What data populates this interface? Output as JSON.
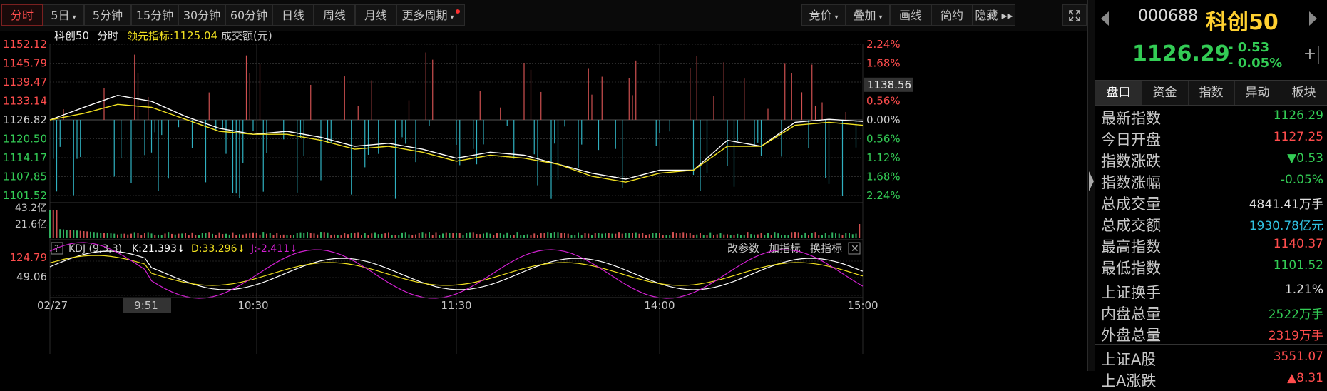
{
  "toolbar": {
    "tabs": [
      {
        "label": "分时",
        "active": true
      },
      {
        "label": "5日",
        "dropdown": true
      },
      {
        "label": "5分钟"
      },
      {
        "label": "15分钟"
      },
      {
        "label": "30分钟"
      },
      {
        "label": "60分钟"
      },
      {
        "label": "日线"
      },
      {
        "label": "周线"
      },
      {
        "label": "月线"
      },
      {
        "label": "更多周期",
        "dropdown": true,
        "dot": true
      }
    ],
    "right_tabs": [
      {
        "label": "竞价",
        "dropdown": true
      },
      {
        "label": "叠加",
        "dropdown": true
      },
      {
        "label": "画线"
      },
      {
        "label": "简约"
      },
      {
        "label": "隐藏 ▸▸"
      }
    ],
    "expand_icon": "fullscreen-icon"
  },
  "chart_header": {
    "name": "科创50",
    "mode": "分时",
    "leading_label": "领先指标:1125.04",
    "volume_label": "成交额(元)"
  },
  "chart_data": [
    {
      "type": "line",
      "title": "",
      "y_left_ticks": [
        "1152.12",
        "1145.79",
        "1139.47",
        "1133.14",
        "1126.82",
        "1120.50",
        "1114.17",
        "1107.85",
        "1101.52"
      ],
      "y_right_ticks": [
        "2.24%",
        "1.68%",
        "1.12%",
        "0.56%",
        "0.00%",
        "0.56%",
        "1.12%",
        "1.68%",
        "2.24%"
      ],
      "current_tag": "1138.56",
      "ylim": [
        1101.52,
        1152.12
      ],
      "x_ticks": [
        "02/27",
        "9:51",
        "10:30",
        "11:30",
        "14:00",
        "15:00"
      ],
      "series": [
        {
          "name": "科创50",
          "color": "#ffffff",
          "x": [
            0,
            10,
            20,
            30,
            40,
            50,
            60,
            70,
            80,
            90,
            100,
            110,
            120,
            130,
            140,
            150,
            160,
            170,
            180,
            190,
            200,
            210,
            220,
            230,
            240
          ],
          "values": [
            1126.8,
            1131,
            1135,
            1133,
            1128,
            1124,
            1122,
            1123,
            1121,
            1118,
            1119,
            1117,
            1114,
            1116,
            1115,
            1112,
            1109,
            1107,
            1110,
            1110,
            1120,
            1118,
            1126,
            1127,
            1126.3
          ]
        },
        {
          "name": "领先指标",
          "color": "#f0e020",
          "x": [
            0,
            10,
            20,
            30,
            40,
            50,
            60,
            70,
            80,
            90,
            100,
            110,
            120,
            130,
            140,
            150,
            160,
            170,
            180,
            190,
            200,
            210,
            220,
            230,
            240
          ],
          "values": [
            1126.8,
            1129,
            1132,
            1131,
            1127,
            1123,
            1122,
            1122,
            1120,
            1117,
            1118,
            1116,
            1113,
            1115,
            1114,
            1112,
            1108,
            1106,
            1109,
            1110,
            1118,
            1118,
            1125,
            1126,
            1125.0
          ]
        }
      ]
    },
    {
      "type": "bar",
      "title": "",
      "y_ticks": [
        "43.2亿",
        "21.6亿"
      ],
      "ylim": [
        0,
        43.2
      ]
    },
    {
      "type": "line",
      "title": "",
      "indicator_label": "KDJ (9,3,3)",
      "k_label": "K:21.393↓",
      "d_label": "D:33.296↓",
      "j_label": "J:-2.411↓",
      "y_ticks": [
        "124.79",
        "49.06"
      ],
      "buttons": [
        "改参数",
        "加指标",
        "换指标"
      ],
      "series": [
        {
          "name": "K",
          "color": "#ffffff"
        },
        {
          "name": "D",
          "color": "#f0e020"
        },
        {
          "name": "J",
          "color": "#d020d0"
        }
      ]
    }
  ],
  "quote": {
    "code": "000688",
    "name": "科创50",
    "price": "1126.29",
    "change": "- 0.53",
    "change_pct": "- 0.05%",
    "tabs": [
      "盘口",
      "资金",
      "指数",
      "异动",
      "板块"
    ],
    "rows": [
      {
        "label": "最新指数",
        "value": "1126.29",
        "color": "#33cc55"
      },
      {
        "label": "今日开盘",
        "value": "1127.25",
        "color": "#ff4d4d"
      },
      {
        "label": "指数涨跌",
        "value": "▼0.53",
        "color": "#33cc55"
      },
      {
        "label": "指数涨幅",
        "value": "-0.05%",
        "color": "#33cc55"
      },
      {
        "label": "总成交量",
        "value": "4841.41万手",
        "color": "#e0e0e0"
      },
      {
        "label": "总成交额",
        "value": "1930.78亿元",
        "color": "#30c0e0"
      },
      {
        "label": "最高指数",
        "value": "1140.37",
        "color": "#ff4d4d"
      },
      {
        "label": "最低指数",
        "value": "1101.52",
        "color": "#33cc55"
      },
      {
        "label": "上证换手",
        "value": "1.21%",
        "color": "#e0e0e0"
      },
      {
        "label": "内盘总量",
        "value": "2522万手",
        "color": "#33cc55"
      },
      {
        "label": "外盘总量",
        "value": "2319万手",
        "color": "#ff4d4d"
      },
      {
        "label": "上证A股",
        "value": "3551.07",
        "color": "#ff4d4d"
      },
      {
        "label": "上A涨跌",
        "value": "▲8.31",
        "color": "#ff4d4d"
      }
    ]
  }
}
